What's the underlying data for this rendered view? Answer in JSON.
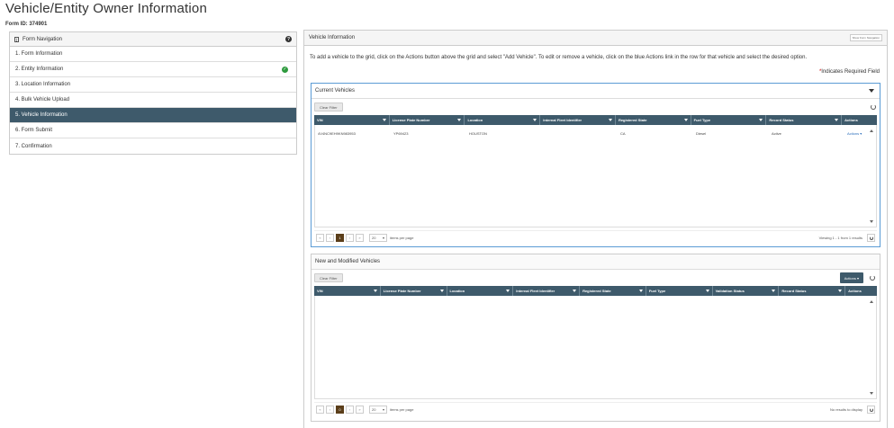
{
  "page": {
    "title": "Vehicle/Entity Owner Information",
    "form_id": "Form ID: 374901"
  },
  "nav": {
    "header": "Form Navigation",
    "items": [
      {
        "label": "1. Form Information",
        "completed": false,
        "active": false
      },
      {
        "label": "2. Entity Information",
        "completed": true,
        "active": false
      },
      {
        "label": "3. Location Information",
        "completed": false,
        "active": false
      },
      {
        "label": "4. Bulk Vehicle Upload",
        "completed": false,
        "active": false
      },
      {
        "label": "5. Vehicle Information",
        "completed": false,
        "active": true
      },
      {
        "label": "6. Form Submit",
        "completed": false,
        "active": false
      },
      {
        "label": "7. Confirmation",
        "completed": false,
        "active": false
      }
    ]
  },
  "main": {
    "header": "Vehicle Information",
    "header_button": "Show Form Navigation",
    "instructions": "To add a vehicle to the grid, click on the Actions button above the grid and select \"Add Vehicle\". To edit or remove a vehicle, click on the blue Actions link in the row for that vehicle and select the desired option.",
    "required_star": "*",
    "required_text": "Indicates Required Field"
  },
  "current_vehicles": {
    "title": "Current Vehicles",
    "clear_filter": "Clear Filter",
    "columns": [
      "VIN",
      "License Plate Number",
      "Location",
      "Internal Fleet Identifier",
      "Registered State",
      "Fuel Type",
      "Record Status",
      "Actions"
    ],
    "rows": [
      {
        "vin": "4V4NC9EH9KN983953",
        "plate": "YP69423",
        "location": "HOUSTON",
        "fleet_id": "",
        "state": "CA",
        "fuel": "Diesel",
        "status": "Active",
        "actions": "Actions ▾"
      }
    ],
    "pager": {
      "first": "«",
      "prev": "‹",
      "page": "1",
      "next": "›",
      "last": "»",
      "per_page": "20",
      "per_page_label": "items per page",
      "status": "Viewing 1 - 1 from 1 results"
    }
  },
  "modified_vehicles": {
    "title": "New and Modified Vehicles",
    "clear_filter": "Clear Filter",
    "actions_button": "Actions ▾",
    "columns": [
      "VIN",
      "License Plate Number",
      "Location",
      "Internal Fleet Identifier",
      "Registered State",
      "Fuel Type",
      "Validation Status",
      "Record Status",
      "Actions"
    ],
    "pager": {
      "first": "«",
      "prev": "‹",
      "page": "0",
      "next": "›",
      "last": "»",
      "per_page": "20",
      "per_page_label": "items per page",
      "status": "No results to display"
    }
  },
  "colors": {
    "header_bg": "#3e5a6b",
    "check": "#2e9a3e",
    "link": "#2a6ebb",
    "page_active": "#5b3e1a"
  }
}
